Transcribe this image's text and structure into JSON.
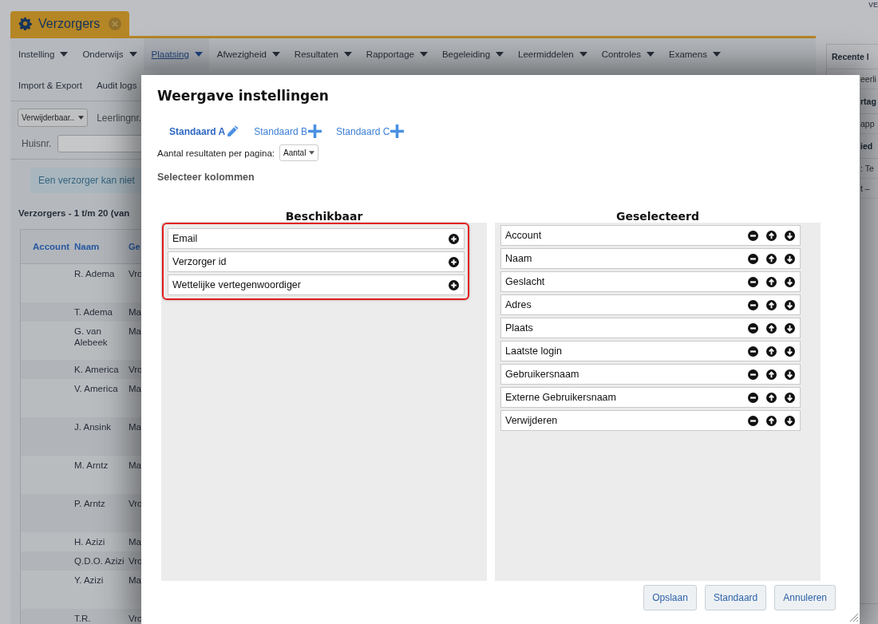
{
  "corner_text": "VE",
  "app_tab": {
    "label": "Verzorgers"
  },
  "menu": [
    {
      "label": "Instelling",
      "dropdown": true,
      "selected": false
    },
    {
      "label": "Onderwijs",
      "dropdown": true,
      "selected": false
    },
    {
      "label": "Plaatsing",
      "dropdown": true,
      "selected": true
    },
    {
      "label": "Afwezigheid",
      "dropdown": true,
      "selected": false
    },
    {
      "label": "Resultaten",
      "dropdown": true,
      "selected": false
    },
    {
      "label": "Rapportage",
      "dropdown": true,
      "selected": false
    },
    {
      "label": "Begeleiding",
      "dropdown": true,
      "selected": false
    },
    {
      "label": "Leermiddelen",
      "dropdown": true,
      "selected": false
    },
    {
      "label": "Controles",
      "dropdown": true,
      "selected": false
    },
    {
      "label": "Examens",
      "dropdown": true,
      "selected": false
    }
  ],
  "menu_row_2": [
    {
      "label": "Import & Export",
      "selected": false
    },
    {
      "label": "Audit logs",
      "selected": false
    }
  ],
  "filters": {
    "status_select": "Verwijderbaar..",
    "leerlingnr_label": "Leerlingnr.",
    "huisnr_label": "Huisnr."
  },
  "notice": "Een verzorger kan niet",
  "list_title": "Verzorgers - 1 t/m 20 (van",
  "table": {
    "columns": [
      "Account",
      "Naam",
      "Ge"
    ],
    "rows": [
      {
        "naam": "R. Adema",
        "geslacht": "Vro",
        "tall": true
      },
      {
        "naam": "T. Adema",
        "geslacht": "Ma",
        "tall": false
      },
      {
        "naam": "G. van Alebeek",
        "geslacht": "Ma",
        "tall": true
      },
      {
        "naam": "K. America",
        "geslacht": "Vro",
        "tall": false
      },
      {
        "naam": "V. America",
        "geslacht": "Ma",
        "tall": true
      },
      {
        "naam": "J. Ansink",
        "geslacht": "Ma",
        "tall": true
      },
      {
        "naam": "M. Arntz",
        "geslacht": "Ma",
        "tall": true
      },
      {
        "naam": "P. Arntz",
        "geslacht": "Vro",
        "tall": true
      },
      {
        "naam": "H. Azizi",
        "geslacht": "Ma",
        "tall": false
      },
      {
        "naam": "Q.D.O. Azizi",
        "geslacht": "Vro",
        "tall": false
      },
      {
        "naam": "Y. Azizi",
        "geslacht": "Ma",
        "tall": true
      },
      {
        "naam": "T.R.",
        "geslacht": "Vro",
        "tall": false
      }
    ]
  },
  "side_panel": [
    {
      "kind": "header",
      "text": "Recente l"
    },
    {
      "kind": "row",
      "text": "eerli"
    },
    {
      "kind": "header",
      "text": "rtag"
    },
    {
      "kind": "row",
      "text": "app"
    },
    {
      "kind": "header",
      "text": "ied"
    },
    {
      "kind": "row",
      "text": ": Te"
    },
    {
      "kind": "row",
      "text": "t –"
    }
  ],
  "dialog": {
    "title": "Weergave instellingen",
    "tabs": [
      {
        "label": "Standaard A",
        "selected": true,
        "kind": "edit"
      },
      {
        "label": "Standaard B",
        "selected": false,
        "kind": "add"
      },
      {
        "label": "Standaard C",
        "selected": false,
        "kind": "add"
      }
    ],
    "per_page_label": "Aantal resultaten per pagina:",
    "per_page_select": "Aantal",
    "section_title": "Selecteer kolommen",
    "available": {
      "title": "Beschikbaar",
      "highlighted": true,
      "items": [
        "Email",
        "Verzorger id",
        "Wettelijke vertegenwoordiger"
      ]
    },
    "selected": {
      "title": "Geselecteerd",
      "items": [
        "Account",
        "Naam",
        "Geslacht",
        "Adres",
        "Plaats",
        "Laatste login",
        "Gebruikersnaam",
        "Externe Gebruikersnaam",
        "Verwijderen"
      ]
    },
    "buttons": [
      "Opslaan",
      "Standaard",
      "Annuleren"
    ]
  }
}
